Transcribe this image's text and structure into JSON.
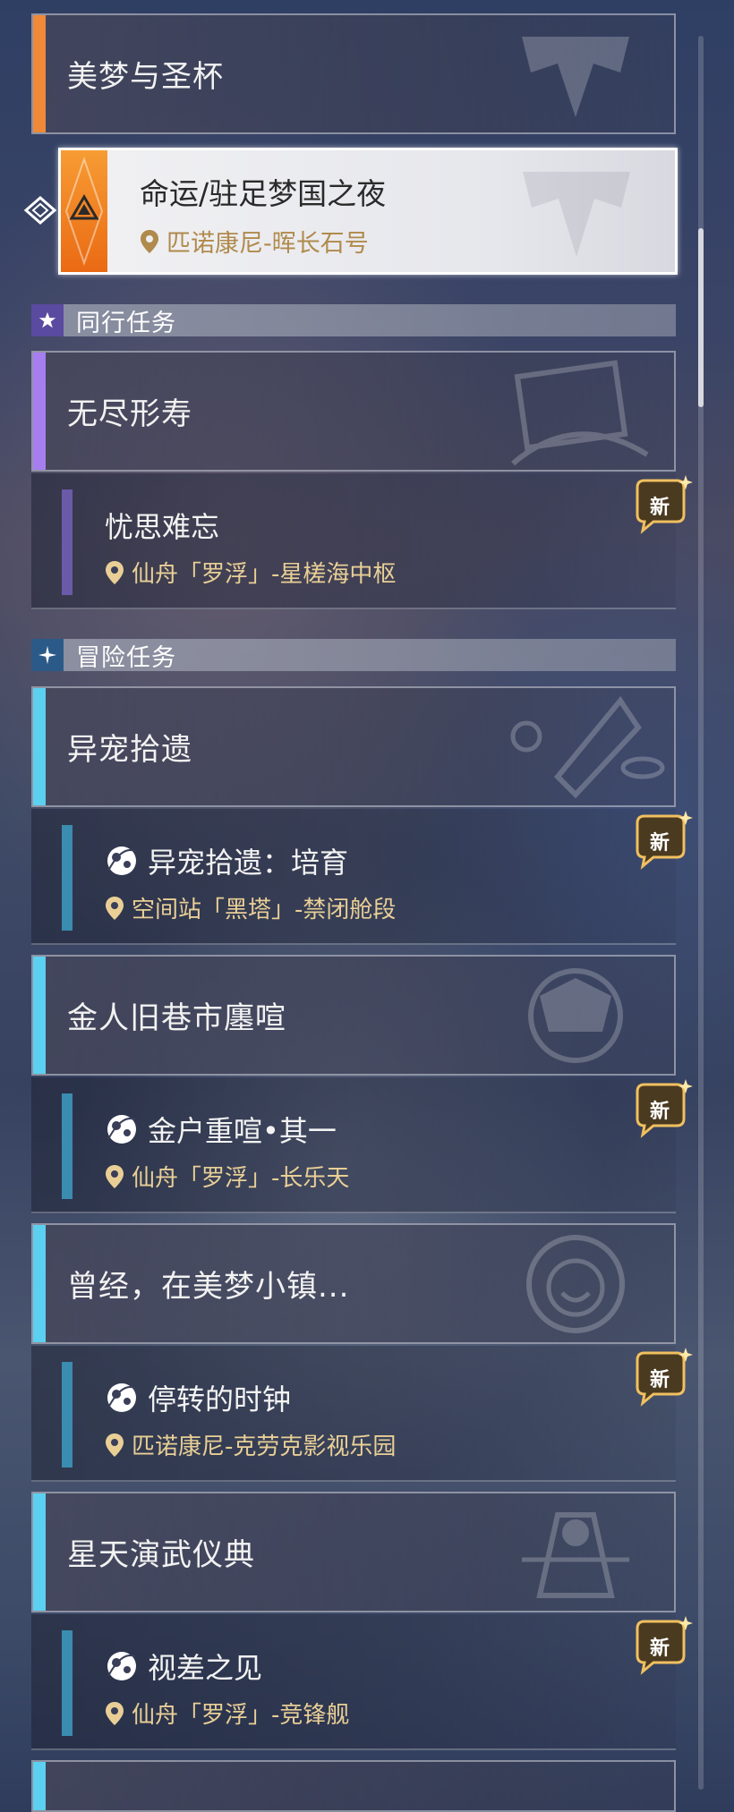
{
  "categories": [
    {
      "title": "美梦与圣杯",
      "accent": "#f08a38"
    },
    {
      "title": "无尽形寿",
      "accent": "#a77ef0"
    },
    {
      "title": "异宠拾遗",
      "accent": "#5cd0f0"
    },
    {
      "title": "金人旧巷市廛喧",
      "accent": "#5cd0f0"
    },
    {
      "title": "曾经，在美梦小镇...",
      "accent": "#5cd0f0"
    },
    {
      "title": "星天演武仪典",
      "accent": "#5cd0f0"
    }
  ],
  "selected_quest": {
    "title": "命运/驻足梦国之夜",
    "location": "匹诺康尼-晖长石号"
  },
  "sections": {
    "companion": {
      "label": "同行任务",
      "icon": "star-icon"
    },
    "adventure": {
      "label": "冒险任务",
      "icon": "sparkle-icon"
    }
  },
  "quests": [
    {
      "title": "忧思难忘",
      "location": "仙舟「罗浮」-星槎海中枢",
      "bar": "#6b5aa8",
      "new": "新",
      "has_icon": false
    },
    {
      "title": "异宠拾遗：培育",
      "location": "空间站「黑塔」-禁闭舱段",
      "bar": "#3a8cb0",
      "new": "新",
      "has_icon": true
    },
    {
      "title": "金户重喧•其一",
      "location": "仙舟「罗浮」-长乐天",
      "bar": "#3a8cb0",
      "new": "新",
      "has_icon": true
    },
    {
      "title": "停转的时钟",
      "location": "匹诺康尼-克劳克影视乐园",
      "bar": "#3a8cb0",
      "new": "新",
      "has_icon": true
    },
    {
      "title": "视差之见",
      "location": "仙舟「罗浮」-竞锋舰",
      "bar": "#3a8cb0",
      "new": "新",
      "has_icon": true
    }
  ],
  "colors": {
    "location_text": "#e9cf96",
    "adventure_accent": "#5cd0f0",
    "companion_accent": "#a77ef0",
    "trailblaze_accent": "#f08a38"
  }
}
